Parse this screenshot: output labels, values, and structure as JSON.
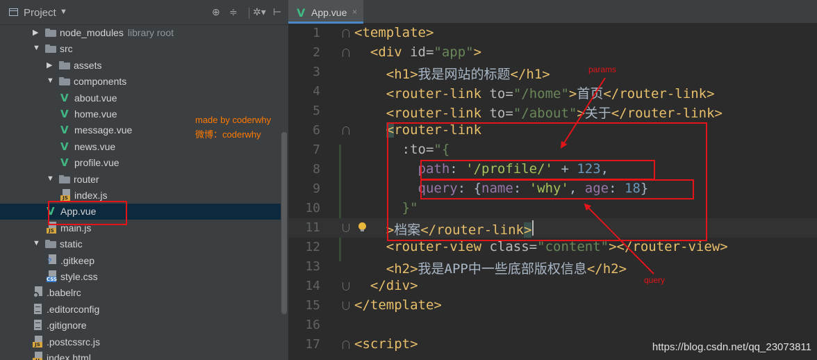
{
  "project_panel": {
    "title": "Project",
    "tools": [
      "⊕",
      "≑",
      "✲▾",
      "⊢"
    ],
    "tree": [
      {
        "label": "node_modules",
        "note": "library root",
        "icon": "folder-icon",
        "depth": 2,
        "arrow": "right"
      },
      {
        "label": "src",
        "icon": "folder-icon",
        "depth": 2,
        "arrow": "down"
      },
      {
        "label": "assets",
        "icon": "folder-icon",
        "depth": 3,
        "arrow": "right"
      },
      {
        "label": "components",
        "icon": "folder-icon",
        "depth": 3,
        "arrow": "down"
      },
      {
        "label": "about.vue",
        "icon": "vue-icon",
        "depth": 4
      },
      {
        "label": "home.vue",
        "icon": "vue-icon",
        "depth": 4
      },
      {
        "label": "message.vue",
        "icon": "vue-icon",
        "depth": 4
      },
      {
        "label": "news.vue",
        "icon": "vue-icon",
        "depth": 4
      },
      {
        "label": "profile.vue",
        "icon": "vue-icon",
        "depth": 4
      },
      {
        "label": "router",
        "icon": "folder-icon",
        "depth": 3,
        "arrow": "down"
      },
      {
        "label": "index.js",
        "icon": "js-file-icon",
        "depth": 4
      },
      {
        "label": "App.vue",
        "icon": "vue-icon",
        "depth": 3,
        "selected": true
      },
      {
        "label": "main.js",
        "icon": "js-file-icon",
        "depth": 3
      },
      {
        "label": "static",
        "icon": "folder-icon",
        "depth": 2,
        "arrow": "down"
      },
      {
        "label": ".gitkeep",
        "icon": "gitkeep-icon",
        "depth": 3
      },
      {
        "label": "style.css",
        "icon": "css-file-icon",
        "depth": 3
      },
      {
        "label": ".babelrc",
        "icon": "babel-icon",
        "depth": 2
      },
      {
        "label": ".editorconfig",
        "icon": "text-file-icon",
        "depth": 2
      },
      {
        "label": ".gitignore",
        "icon": "text-file-icon",
        "depth": 2
      },
      {
        "label": ".postcssrc.js",
        "icon": "js-file-icon",
        "depth": 2
      },
      {
        "label": "index.html",
        "icon": "html-file-icon",
        "depth": 2
      }
    ]
  },
  "annotation": {
    "line1": "made by coderwhy",
    "line2": "微博：coderwhy"
  },
  "editor": {
    "tab_label": "App.vue",
    "tab_close": "×",
    "lines": [
      {
        "n": "1",
        "segs": [
          [
            "tg",
            "<template>"
          ]
        ],
        "fold": "up"
      },
      {
        "n": "2",
        "segs": [
          [
            "tx",
            "  "
          ],
          [
            "tg",
            "<div "
          ],
          [
            "at",
            "id="
          ],
          [
            "st",
            "\"app\""
          ],
          [
            "tg",
            ">"
          ]
        ],
        "fold": "up"
      },
      {
        "n": "3",
        "segs": [
          [
            "tx",
            "    "
          ],
          [
            "tg",
            "<h1>"
          ],
          [
            "tx",
            "我是网站的标题"
          ],
          [
            "tg",
            "</h1>"
          ]
        ]
      },
      {
        "n": "4",
        "segs": [
          [
            "tx",
            "    "
          ],
          [
            "tg",
            "<router-link "
          ],
          [
            "at",
            "to="
          ],
          [
            "st",
            "\"/home\""
          ],
          [
            "tg",
            ">"
          ],
          [
            "tx",
            "首页"
          ],
          [
            "tg",
            "</router-link>"
          ]
        ]
      },
      {
        "n": "5",
        "segs": [
          [
            "tx",
            "    "
          ],
          [
            "tg",
            "<router-link "
          ],
          [
            "at",
            "to="
          ],
          [
            "st",
            "\"/about\""
          ],
          [
            "tg",
            ">"
          ],
          [
            "tx",
            "关于"
          ],
          [
            "tg",
            "</router-link>"
          ]
        ]
      },
      {
        "n": "6",
        "segs": [
          [
            "tx",
            "    "
          ],
          [
            "tg-hl",
            "<"
          ],
          [
            "tg",
            "router-link"
          ]
        ],
        "fold": "up"
      },
      {
        "n": "7",
        "segs": [
          [
            "tx",
            "      "
          ],
          [
            "at",
            ":to="
          ],
          [
            "st",
            "\"{"
          ]
        ]
      },
      {
        "n": "8",
        "segs": [
          [
            "tx",
            "        "
          ],
          [
            "prop",
            "path"
          ],
          [
            "tx",
            ": "
          ],
          [
            "str",
            "'/profile/'"
          ],
          [
            "tx",
            " + "
          ],
          [
            "num",
            "123"
          ],
          [
            "tx",
            ","
          ]
        ]
      },
      {
        "n": "9",
        "segs": [
          [
            "tx",
            "        "
          ],
          [
            "prop",
            "query"
          ],
          [
            "tx",
            ": {"
          ],
          [
            "prop",
            "name"
          ],
          [
            "tx",
            ": "
          ],
          [
            "str",
            "'why'"
          ],
          [
            "tx",
            ", "
          ],
          [
            "prop",
            "age"
          ],
          [
            "tx",
            ": "
          ],
          [
            "num",
            "18"
          ],
          [
            "tx",
            "}"
          ]
        ]
      },
      {
        "n": "10",
        "segs": [
          [
            "tx",
            "      "
          ],
          [
            "st",
            "}\""
          ]
        ]
      },
      {
        "n": "11",
        "segs": [
          [
            "tx",
            "    "
          ],
          [
            "tg",
            ">"
          ],
          [
            "tx",
            "档案"
          ],
          [
            "tg",
            "</router-link"
          ],
          [
            "tg-hl",
            ">"
          ]
        ],
        "fold": "down",
        "current": true,
        "bulb": true
      },
      {
        "n": "12",
        "segs": [
          [
            "tx",
            "    "
          ],
          [
            "tg",
            "<router-view "
          ],
          [
            "at",
            "class="
          ],
          [
            "st",
            "\"content\""
          ],
          [
            "tg",
            "></router-view>"
          ]
        ]
      },
      {
        "n": "13",
        "segs": [
          [
            "tx",
            "    "
          ],
          [
            "tg",
            "<h2>"
          ],
          [
            "tx",
            "我是APP中一些底部版权信息"
          ],
          [
            "tg",
            "</h2>"
          ]
        ]
      },
      {
        "n": "14",
        "segs": [
          [
            "tx",
            "  "
          ],
          [
            "tg",
            "</div>"
          ]
        ],
        "fold": "down"
      },
      {
        "n": "15",
        "segs": [
          [
            "tg",
            "</template>"
          ]
        ],
        "fold": "down"
      },
      {
        "n": "16",
        "segs": []
      },
      {
        "n": "17",
        "segs": [
          [
            "tg",
            "<script>"
          ]
        ],
        "fold": "up"
      }
    ]
  },
  "labels": {
    "params": "params",
    "query": "query"
  },
  "watermark": "https://blog.csdn.net/qq_23073811",
  "colors": {
    "vue_green": "#41b883",
    "annotation_red": "#e3141a",
    "annotation_orange": "#ff7a00"
  }
}
